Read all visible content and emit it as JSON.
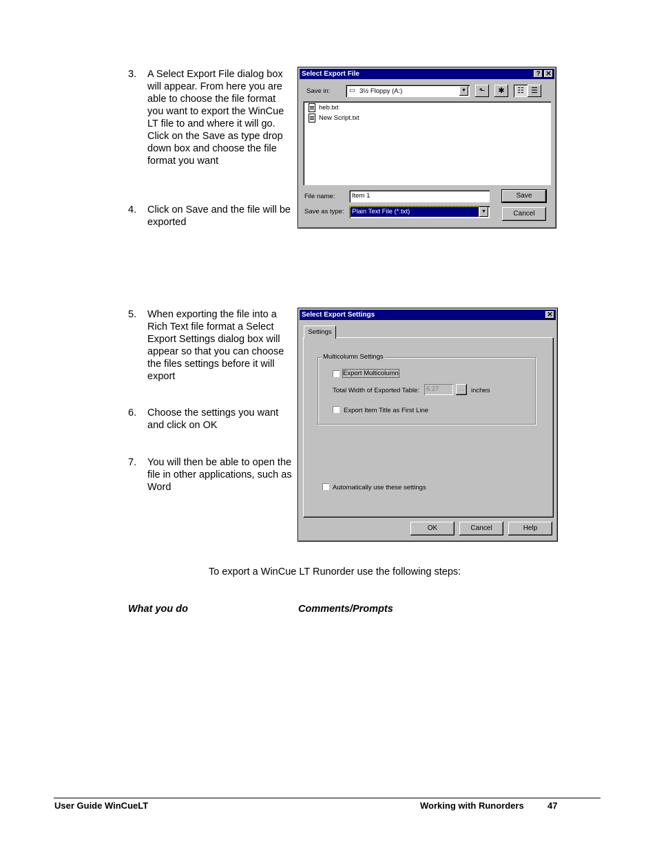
{
  "steps": [
    {
      "number": "3.",
      "text": "A Select Export File dialog box will appear. From here you are able to choose the file format you want to export the WinCue LT file to and where it will go. Click on the Save as type drop down box and choose the file format you want"
    },
    {
      "number": "4.",
      "text": "Click on Save and the file will be exported"
    },
    {
      "number": "5.",
      "text": "When exporting the file into a Rich Text file format a Select Export Settings dialog box will appear so that you can choose the files settings before it will export"
    },
    {
      "number": "6.",
      "text": "Choose the settings you want and click on OK"
    },
    {
      "number": "7.",
      "text": "You will then be able to open the file in other applications, such as Word"
    }
  ],
  "export_file_dialog": {
    "title": "Select Export File",
    "help_glyph": "?",
    "close_glyph": "✕",
    "save_in_label": "Save in:",
    "save_in_value": "3½ Floppy (A:)",
    "files": [
      "heb.txt",
      "New Script.txt"
    ],
    "file_name_label": "File name:",
    "file_name_value": "Item 1",
    "save_as_type_label": "Save as type:",
    "save_as_type_value": "Plain Text File (*.txt)",
    "save_button": "Save",
    "cancel_button": "Cancel",
    "dropdown_glyph": "▼",
    "up_folder_glyph": "⬑",
    "new_folder_glyph": "✱",
    "list_view_glyph": "☷",
    "details_view_glyph": "☰"
  },
  "export_settings_dialog": {
    "title": "Select Export Settings",
    "close_glyph": "✕",
    "tab_label": "Settings",
    "group_label": "Multicolumn Settings",
    "export_multicolumn_label": "Export Multicolumn",
    "export_multicolumn_checked": false,
    "total_width_label": "Total Width of Exported Table:",
    "total_width_value": "6.27",
    "ellipsis_button": "...",
    "units_label": "inches",
    "export_item_title_label": "Export Item Title as First Line",
    "export_item_title_checked": false,
    "auto_use_label": "Automatically use these settings",
    "auto_use_checked": false,
    "ok_button": "OK",
    "cancel_button": "Cancel",
    "help_button": "Help"
  },
  "intro_text": "To export a WinCue LT Runorder use the following steps:",
  "table_headers": {
    "what_you_do": "What you do",
    "comments": "Comments/Prompts"
  },
  "footer": {
    "left": "User Guide WinCueLT",
    "section": "Working with Runorders",
    "page_number": "47"
  }
}
